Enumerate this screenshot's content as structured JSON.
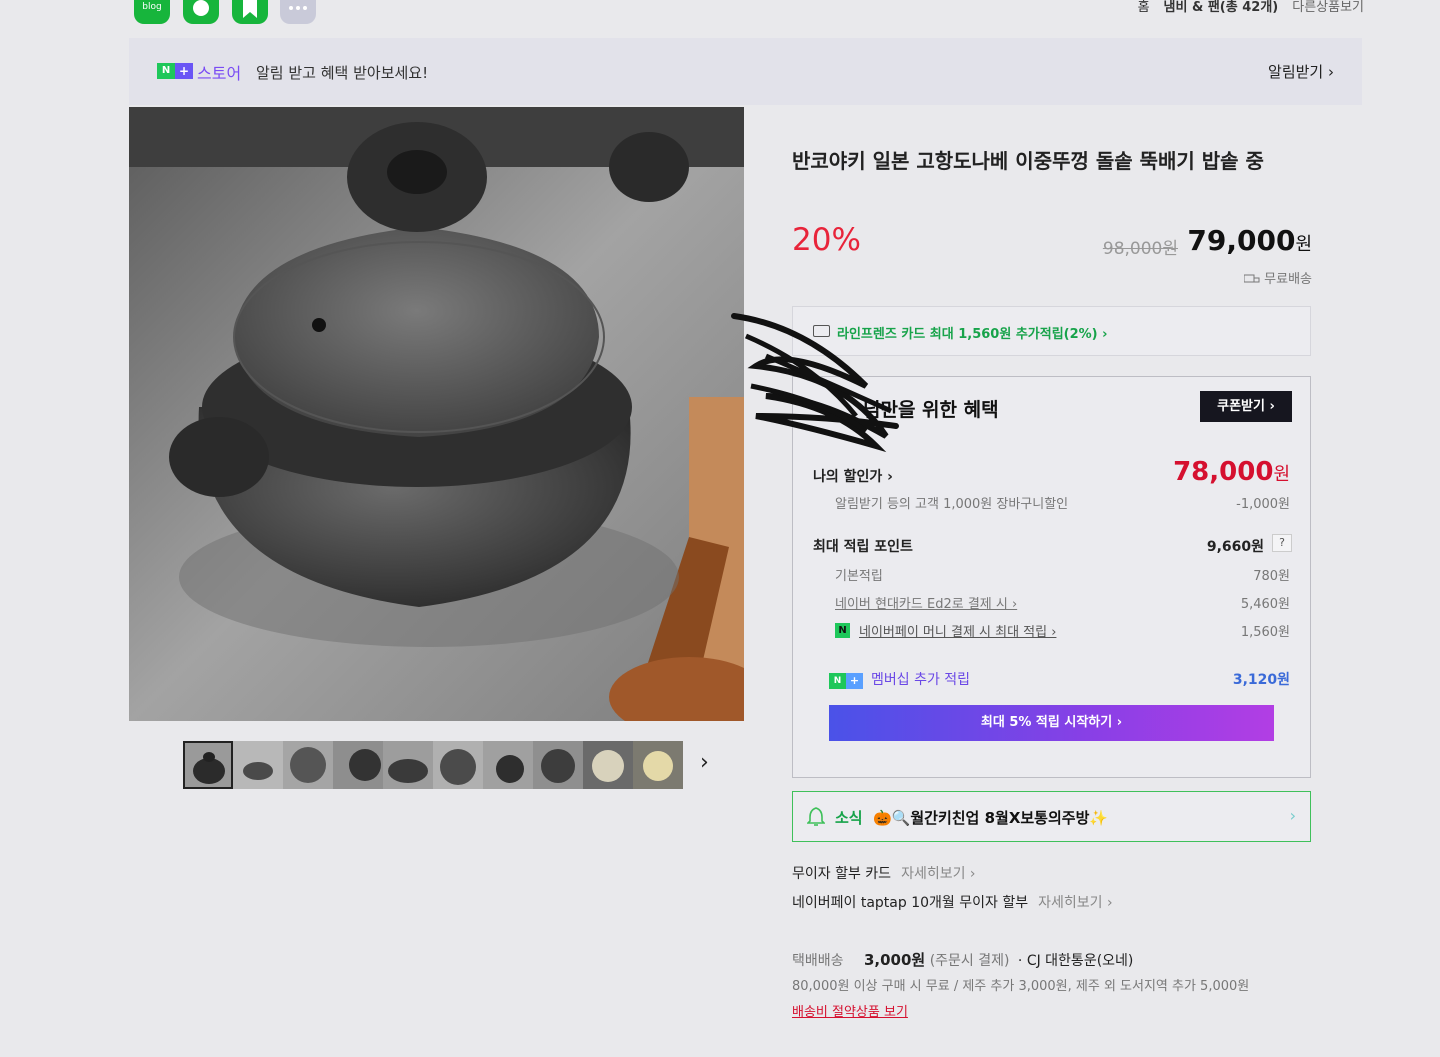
{
  "share": {
    "blog_label": "blog",
    "icons": [
      "blog-icon",
      "band-icon",
      "bookmark-icon",
      "more-icon"
    ]
  },
  "breadcrumb": {
    "home": "홈",
    "category": "냄비 & 팬(총 42개)",
    "other_products": "다른상품보기"
  },
  "notice": {
    "badge_n": "N",
    "badge_plus": "+",
    "store": "스토어",
    "message": "알림 받고 혜택 받아보세요!",
    "alarm_button": "알림받기 ›"
  },
  "product": {
    "title": "반코야키 일본 고항도나베 이중뚜껑 돌솥 뚝배기 밥솥 중",
    "discount_rate": "20%",
    "original_price": "98,000원",
    "sale_price_num": "79,000",
    "won": "원",
    "shipping_badge": "무료배송"
  },
  "thumbnails": {
    "count": 10,
    "next": "›"
  },
  "card_promo": {
    "text": "라인프렌즈 카드 최대 1,560원 추가적립(2%) ›"
  },
  "benefit": {
    "title": "님만을 위한 혜택",
    "coupon_button": "쿠폰받기 ›",
    "my_price_label": "나의 할인가 ›",
    "my_price_num": "78,000",
    "my_price_unit": "원",
    "discount_desc": "알림받기 등의 고객 1,000원 장바구니할인",
    "discount_value": "-1,000원",
    "points_label": "최대 적립 포인트",
    "points_value": "9,660원",
    "question": "?",
    "basic_label": "기본적립",
    "basic_value": "780원",
    "card_label": "네이버 현대카드 Ed2로 결제 시 ›",
    "card_value": "5,460원",
    "pay_icon": "N",
    "pay_label": "네이버페이 머니 결제 시 최대 적립 ›",
    "pay_value": "1,560원",
    "membership_label": "멤버십 추가 적립",
    "membership_value": "3,120원",
    "cta": "최대 5% 적립 시작하기 ›"
  },
  "news": {
    "label": "소식",
    "text": "🎃🔍월간키친업 8월X보통의주방✨",
    "arrow": "›"
  },
  "installment": {
    "card_label": "무이자 할부 카드",
    "card_more": "자세히보기 ›",
    "pay_label": "네이버페이 taptap 10개월 무이자 할부",
    "pay_more": "자세히보기 ›"
  },
  "delivery": {
    "label": "택배배송",
    "fee": "3,000원",
    "note": "(주문시 결제)",
    "carrier": "· CJ 대한통운(오네)",
    "detail": "80,000원 이상 구매 시 무료 / 제주 추가 3,000원, 제주 외 도서지역 추가 5,000원",
    "saving_link": "배송비 절약상품 보기"
  },
  "colors": {
    "accent_red": "#e8243a",
    "naver_green": "#17b53c",
    "purple": "#7a4cf4",
    "cta_gradient_start": "#4a52e8",
    "cta_gradient_end": "#b23ee4"
  }
}
